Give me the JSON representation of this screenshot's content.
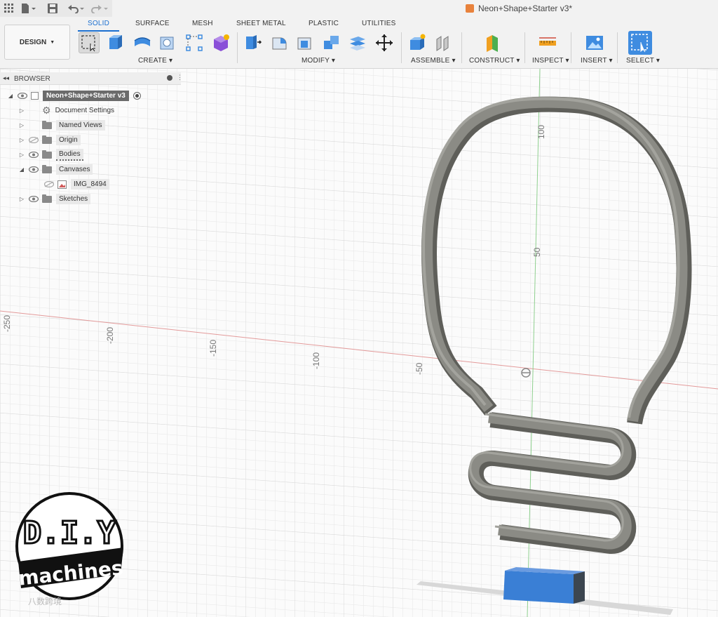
{
  "titlebar": {
    "doc_title": "Neon+Shape+Starter v3*"
  },
  "workspace": {
    "design_label": "DESIGN",
    "tabs": [
      {
        "label": "SOLID"
      },
      {
        "label": "SURFACE"
      },
      {
        "label": "MESH"
      },
      {
        "label": "SHEET METAL"
      },
      {
        "label": "PLASTIC"
      },
      {
        "label": "UTILITIES"
      }
    ]
  },
  "ribbon": {
    "groups": [
      {
        "label": "CREATE"
      },
      {
        "label": "MODIFY"
      },
      {
        "label": "ASSEMBLE"
      },
      {
        "label": "CONSTRUCT"
      },
      {
        "label": "INSPECT"
      },
      {
        "label": "INSERT"
      },
      {
        "label": "SELECT"
      }
    ]
  },
  "browser": {
    "header": "BROWSER",
    "root": "Neon+Shape+Starter v3",
    "items": [
      {
        "label": "Document Settings"
      },
      {
        "label": "Named Views"
      },
      {
        "label": "Origin"
      },
      {
        "label": "Bodies"
      },
      {
        "label": "Canvases"
      },
      {
        "label": "IMG_8494"
      },
      {
        "label": "Sketches"
      }
    ]
  },
  "viewport": {
    "axis_ticks": [
      "-250",
      "-200",
      "-150",
      "-100",
      "-50",
      "50",
      "100"
    ]
  },
  "logo": {
    "line1": "D.I.Y",
    "line2": "machines"
  },
  "watermark": "八数跨境",
  "colors": {
    "accent": "#1b6fd0",
    "model_gray": "#8b8b85",
    "model_dark": "#5f5f5a",
    "base_blue": "#3a7fd5"
  }
}
